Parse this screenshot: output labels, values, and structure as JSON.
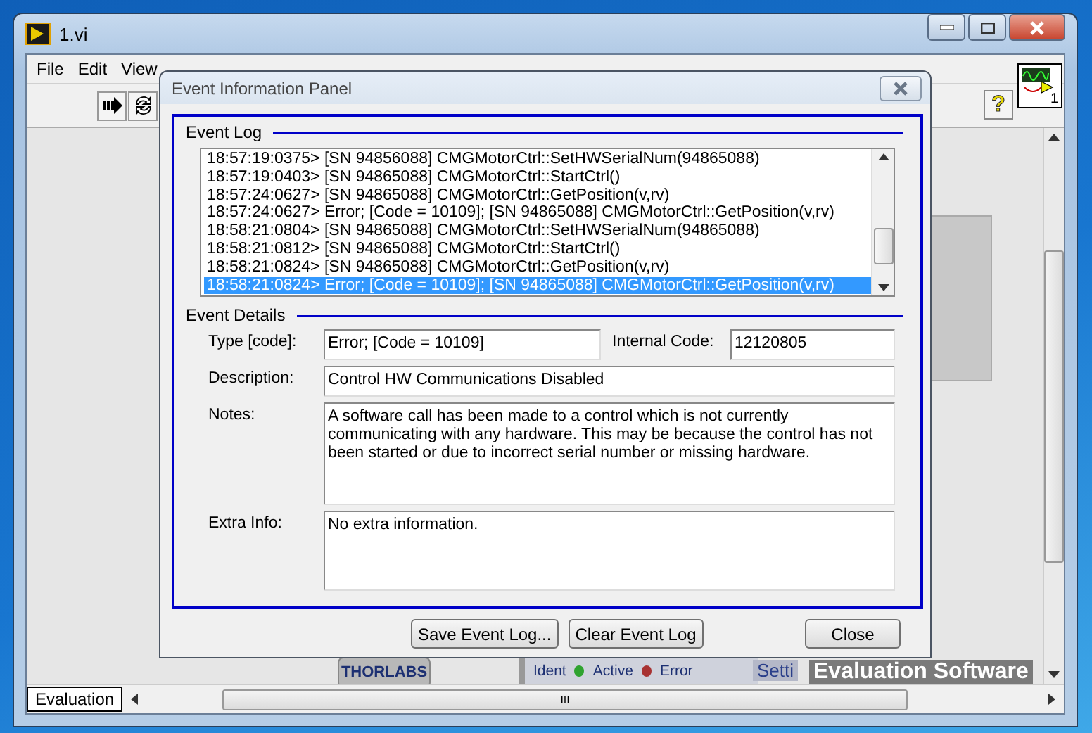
{
  "window": {
    "title": "1.vi",
    "menu": [
      "File",
      "Edit",
      "View"
    ],
    "vi_number": "1",
    "help": "?"
  },
  "front_panel": {
    "logo": "THORLABS",
    "indicators": [
      {
        "label": "Ident",
        "kind": "text"
      },
      {
        "label": "Active",
        "kind": "led",
        "color": "#2fa32f"
      },
      {
        "label": "Error",
        "kind": "led",
        "color": "#a83232"
      }
    ],
    "tab": "Setti",
    "watermark": "Evaluation Software"
  },
  "status": {
    "tab": "Evaluation",
    "scroll_grip": "III"
  },
  "dialog": {
    "title": "Event Information Panel",
    "event_log": {
      "title": "Event Log",
      "entries": [
        {
          "text": "18:57:19:0375> [SN 94856088] CMGMotorCtrl::SetHWSerialNum(94865088)",
          "selected": false
        },
        {
          "text": "18:57:19:0403> [SN 94865088] CMGMotorCtrl::StartCtrl()",
          "selected": false
        },
        {
          "text": "18:57:24:0627> [SN 94865088] CMGMotorCtrl::GetPosition(v,rv)",
          "selected": false
        },
        {
          "text": "18:57:24:0627> Error; [Code = 10109]; [SN 94865088] CMGMotorCtrl::GetPosition(v,rv)",
          "selected": false
        },
        {
          "text": "18:58:21:0804> [SN 94865088] CMGMotorCtrl::SetHWSerialNum(94865088)",
          "selected": false
        },
        {
          "text": "18:58:21:0812> [SN 94865088] CMGMotorCtrl::StartCtrl()",
          "selected": false
        },
        {
          "text": "18:58:21:0824> [SN 94865088] CMGMotorCtrl::GetPosition(v,rv)",
          "selected": false
        },
        {
          "text": "18:58:21:0824> Error; [Code = 10109]; [SN 94865088] CMGMotorCtrl::GetPosition(v,rv)",
          "selected": true
        }
      ]
    },
    "event_details": {
      "title": "Event Details",
      "type_label": "Type [code]:",
      "type_value": "Error; [Code = 10109]",
      "internal_label": "Internal Code:",
      "internal_value": "12120805",
      "description_label": "Description:",
      "description_value": "Control HW Communications Disabled",
      "notes_label": "Notes:",
      "notes_value": "A software call has been made to a control which is not currently communicating with any hardware. This may be because the control has not been started or due to incorrect serial number or missing hardware.",
      "extra_label": "Extra Info:",
      "extra_value": "No extra information."
    },
    "buttons": [
      {
        "label": "Save Event Log...",
        "kind": "left"
      },
      {
        "label": "Clear Event Log",
        "kind": "left"
      },
      {
        "label": "Close",
        "kind": "right"
      }
    ]
  }
}
